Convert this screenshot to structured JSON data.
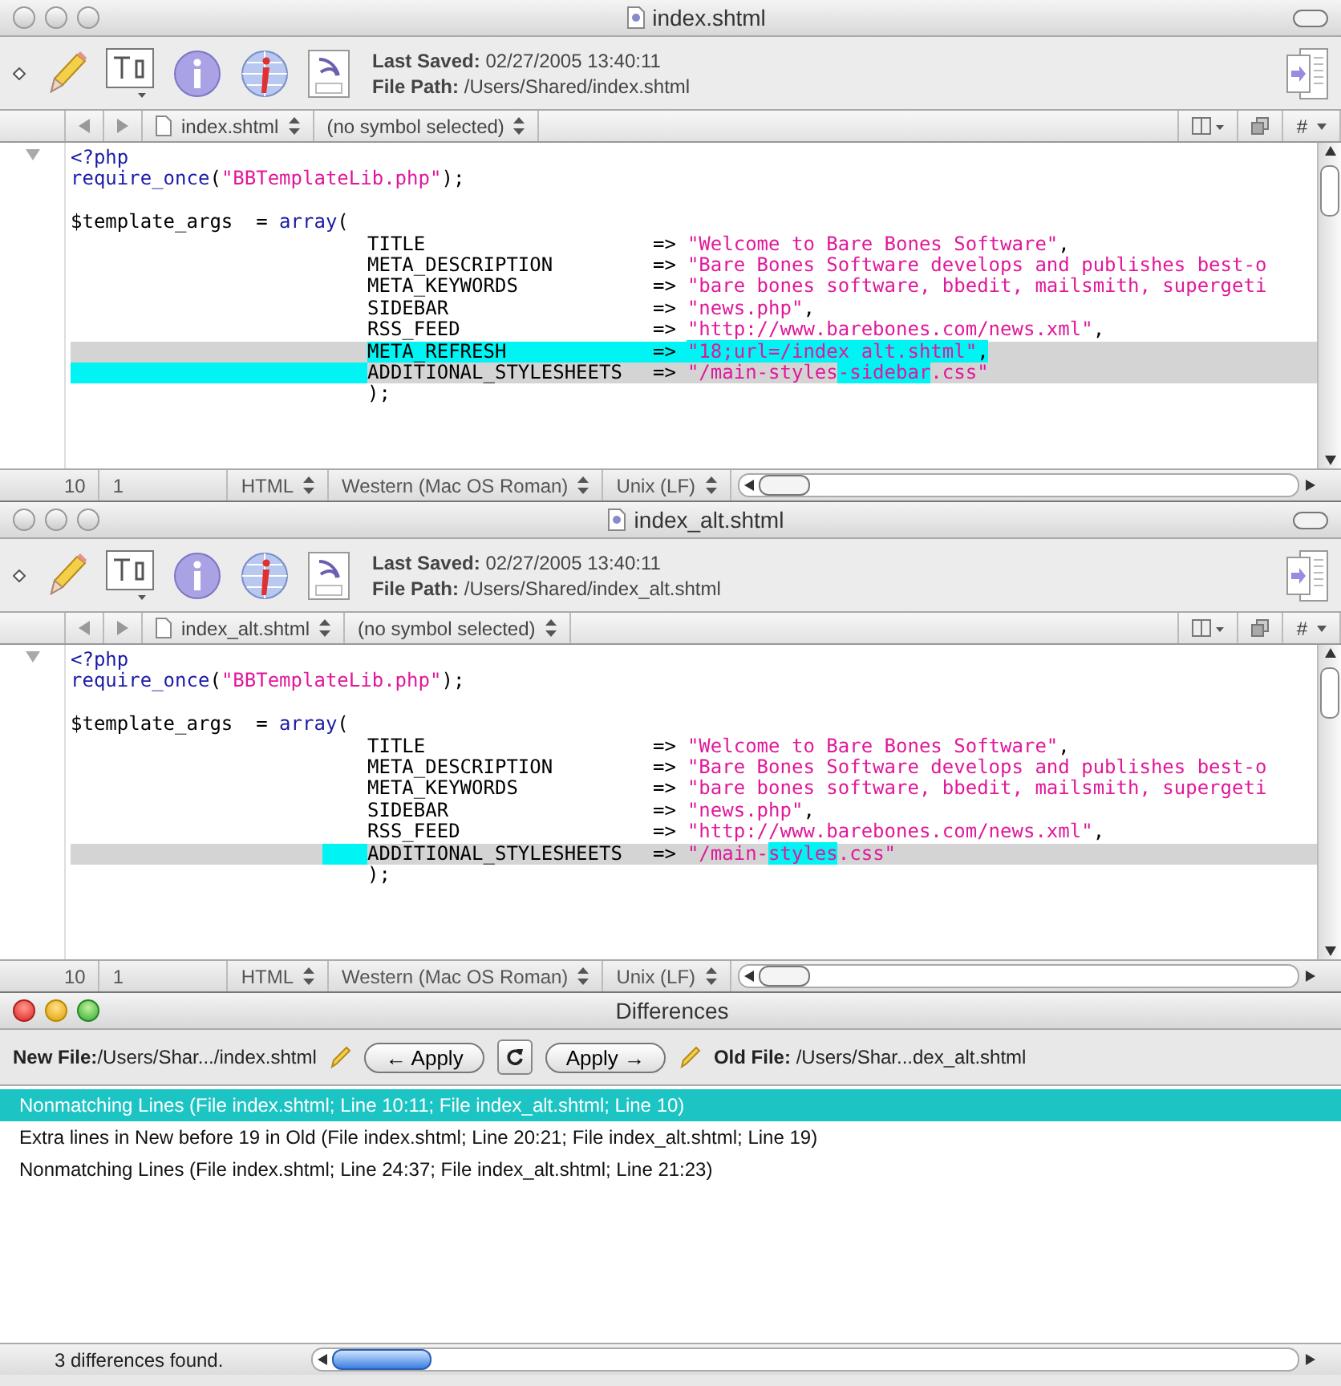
{
  "windows": [
    {
      "title": "index.shtml",
      "last_saved_label": "Last Saved:",
      "last_saved": "02/27/2005 13:40:11",
      "file_path_label": "File Path:",
      "file_path": "/Users/Shared/index.shtml",
      "nav": {
        "file": "index.shtml",
        "symbol": "(no symbol selected)",
        "counter": "#"
      },
      "lines": [
        {
          "kind": "code",
          "segments": [
            {
              "text": "<?php",
              "kind": "keyword"
            }
          ]
        },
        {
          "kind": "code",
          "segments": [
            {
              "text": "require_once",
              "kind": "keyword"
            },
            {
              "text": "(",
              "kind": "plain"
            },
            {
              "text": "\"BBTemplateLib.php\"",
              "kind": "string"
            },
            {
              "text": ");",
              "kind": "plain"
            }
          ]
        },
        {
          "kind": "blank"
        },
        {
          "kind": "code",
          "segments": [
            {
              "text": "$template_args  = ",
              "kind": "plain"
            },
            {
              "text": "array",
              "kind": "keyword"
            },
            {
              "text": "(",
              "kind": "plain"
            }
          ]
        },
        {
          "kind": "arg",
          "changed": false,
          "indent_marked": false,
          "key_lead_marked": false,
          "key": {
            "text": "TITLE",
            "marked": false
          },
          "arrow": {
            "text": "=>",
            "marked": false
          },
          "value": [
            {
              "text": "\"Welcome to Bare Bones Software\"",
              "kind": "string",
              "marked": false
            },
            {
              "text": ",",
              "kind": "plain",
              "marked": false
            }
          ]
        },
        {
          "kind": "arg",
          "changed": false,
          "indent_marked": false,
          "key_lead_marked": false,
          "key": {
            "text": "META_DESCRIPTION",
            "marked": false
          },
          "arrow": {
            "text": "=>",
            "marked": false
          },
          "value": [
            {
              "text": "\"Bare Bones Software develops and publishes best-o",
              "kind": "string",
              "marked": false
            }
          ]
        },
        {
          "kind": "arg",
          "changed": false,
          "indent_marked": false,
          "key_lead_marked": false,
          "key": {
            "text": "META_KEYWORDS",
            "marked": false
          },
          "arrow": {
            "text": "=>",
            "marked": false
          },
          "value": [
            {
              "text": "\"bare bones software, bbedit, mailsmith, supergeti",
              "kind": "string",
              "marked": false
            }
          ]
        },
        {
          "kind": "arg",
          "changed": false,
          "indent_marked": false,
          "key_lead_marked": false,
          "key": {
            "text": "SIDEBAR",
            "marked": false
          },
          "arrow": {
            "text": "=>",
            "marked": false
          },
          "value": [
            {
              "text": "\"news.php\"",
              "kind": "string",
              "marked": false
            },
            {
              "text": ",",
              "kind": "plain",
              "marked": false
            }
          ]
        },
        {
          "kind": "arg",
          "changed": false,
          "indent_marked": false,
          "key_lead_marked": false,
          "key": {
            "text": "RSS_FEED",
            "marked": false
          },
          "arrow": {
            "text": "=>",
            "marked": false
          },
          "value": [
            {
              "text": "\"http://www.barebones.com/news.xml\"",
              "kind": "string",
              "marked": false
            },
            {
              "text": ",",
              "kind": "plain",
              "marked": false
            }
          ]
        },
        {
          "kind": "arg",
          "changed": true,
          "indent_marked": false,
          "key_lead_marked": false,
          "key": {
            "text": "META_REFRESH",
            "marked": true
          },
          "arrow": {
            "text": "=>",
            "marked": true
          },
          "value": [
            {
              "text": "\"18;url=/index_alt.shtml\"",
              "kind": "string",
              "marked": true
            },
            {
              "text": ",",
              "kind": "plain",
              "marked": true
            }
          ]
        },
        {
          "kind": "arg",
          "changed": true,
          "indent_marked": true,
          "key_lead_marked": true,
          "key": {
            "text": "ADDITIONAL_STYLESHEETS",
            "marked": false
          },
          "arrow": {
            "text": "=>",
            "marked": false
          },
          "value": [
            {
              "text": "\"/main-styles",
              "kind": "string",
              "marked": false
            },
            {
              "text": "-sidebar",
              "kind": "string",
              "marked": true
            },
            {
              "text": ".css\"",
              "kind": "string",
              "marked": false
            }
          ]
        },
        {
          "kind": "close",
          "segments": [
            {
              "text": ");",
              "kind": "plain"
            }
          ]
        }
      ],
      "status": {
        "line": "10",
        "column": "1",
        "language": "HTML",
        "encoding": "Western (Mac OS Roman)",
        "line_endings": "Unix (LF)"
      }
    },
    {
      "title": "index_alt.shtml",
      "last_saved_label": "Last Saved:",
      "last_saved": "02/27/2005 13:40:11",
      "file_path_label": "File Path:",
      "file_path": "/Users/Shared/index_alt.shtml",
      "nav": {
        "file": "index_alt.shtml",
        "symbol": "(no symbol selected)",
        "counter": "#"
      },
      "lines": [
        {
          "kind": "code",
          "segments": [
            {
              "text": "<?php",
              "kind": "keyword"
            }
          ]
        },
        {
          "kind": "code",
          "segments": [
            {
              "text": "require_once",
              "kind": "keyword"
            },
            {
              "text": "(",
              "kind": "plain"
            },
            {
              "text": "\"BBTemplateLib.php\"",
              "kind": "string"
            },
            {
              "text": ");",
              "kind": "plain"
            }
          ]
        },
        {
          "kind": "blank"
        },
        {
          "kind": "code",
          "segments": [
            {
              "text": "$template_args  = ",
              "kind": "plain"
            },
            {
              "text": "array",
              "kind": "keyword"
            },
            {
              "text": "(",
              "kind": "plain"
            }
          ]
        },
        {
          "kind": "arg",
          "changed": false,
          "indent_marked": false,
          "key_lead_marked": false,
          "key": {
            "text": "TITLE",
            "marked": false
          },
          "arrow": {
            "text": "=>",
            "marked": false
          },
          "value": [
            {
              "text": "\"Welcome to Bare Bones Software\"",
              "kind": "string",
              "marked": false
            },
            {
              "text": ",",
              "kind": "plain",
              "marked": false
            }
          ]
        },
        {
          "kind": "arg",
          "changed": false,
          "indent_marked": false,
          "key_lead_marked": false,
          "key": {
            "text": "META_DESCRIPTION",
            "marked": false
          },
          "arrow": {
            "text": "=>",
            "marked": false
          },
          "value": [
            {
              "text": "\"Bare Bones Software develops and publishes best-o",
              "kind": "string",
              "marked": false
            }
          ]
        },
        {
          "kind": "arg",
          "changed": false,
          "indent_marked": false,
          "key_lead_marked": false,
          "key": {
            "text": "META_KEYWORDS",
            "marked": false
          },
          "arrow": {
            "text": "=>",
            "marked": false
          },
          "value": [
            {
              "text": "\"bare bones software, bbedit, mailsmith, supergeti",
              "kind": "string",
              "marked": false
            }
          ]
        },
        {
          "kind": "arg",
          "changed": false,
          "indent_marked": false,
          "key_lead_marked": false,
          "key": {
            "text": "SIDEBAR",
            "marked": false
          },
          "arrow": {
            "text": "=>",
            "marked": false
          },
          "value": [
            {
              "text": "\"news.php\"",
              "kind": "string",
              "marked": false
            },
            {
              "text": ",",
              "kind": "plain",
              "marked": false
            }
          ]
        },
        {
          "kind": "arg",
          "changed": false,
          "indent_marked": false,
          "key_lead_marked": false,
          "key": {
            "text": "RSS_FEED",
            "marked": false
          },
          "arrow": {
            "text": "=>",
            "marked": false
          },
          "value": [
            {
              "text": "\"http://www.barebones.com/news.xml\"",
              "kind": "string",
              "marked": false
            },
            {
              "text": ",",
              "kind": "plain",
              "marked": false
            }
          ]
        },
        {
          "kind": "arg",
          "changed": true,
          "indent_marked": false,
          "key_lead_marked": true,
          "key": {
            "text": "ADDITIONAL_STYLESHEETS",
            "marked": false
          },
          "arrow": {
            "text": "=>",
            "marked": false
          },
          "value": [
            {
              "text": "\"/main-",
              "kind": "string",
              "marked": false
            },
            {
              "text": "styles",
              "kind": "string",
              "marked": true
            },
            {
              "text": ".css\"",
              "kind": "string",
              "marked": false
            }
          ]
        },
        {
          "kind": "close",
          "segments": [
            {
              "text": ");",
              "kind": "plain"
            }
          ]
        }
      ],
      "status": {
        "line": "10",
        "column": "1",
        "language": "HTML",
        "encoding": "Western (Mac OS Roman)",
        "line_endings": "Unix (LF)"
      }
    }
  ],
  "differences": {
    "title": "Differences",
    "new_file_label": "New File:",
    "new_file": "/Users/Shar.../index.shtml",
    "apply_left": "← Apply",
    "apply_right": "Apply →",
    "old_file_label": "Old File:",
    "old_file": "/Users/Shar...dex_alt.shtml",
    "items": [
      {
        "text": "Nonmatching Lines (File index.shtml; Line 10:11; File index_alt.shtml; Line 10)",
        "selected": true
      },
      {
        "text": "Extra lines in New before 19 in Old (File index.shtml; Line 20:21; File index_alt.shtml; Line 19)",
        "selected": false
      },
      {
        "text": "Nonmatching Lines (File index.shtml; Line 24:37; File index_alt.shtml; Line 21:23)",
        "selected": false
      }
    ],
    "status": "3 differences found."
  }
}
